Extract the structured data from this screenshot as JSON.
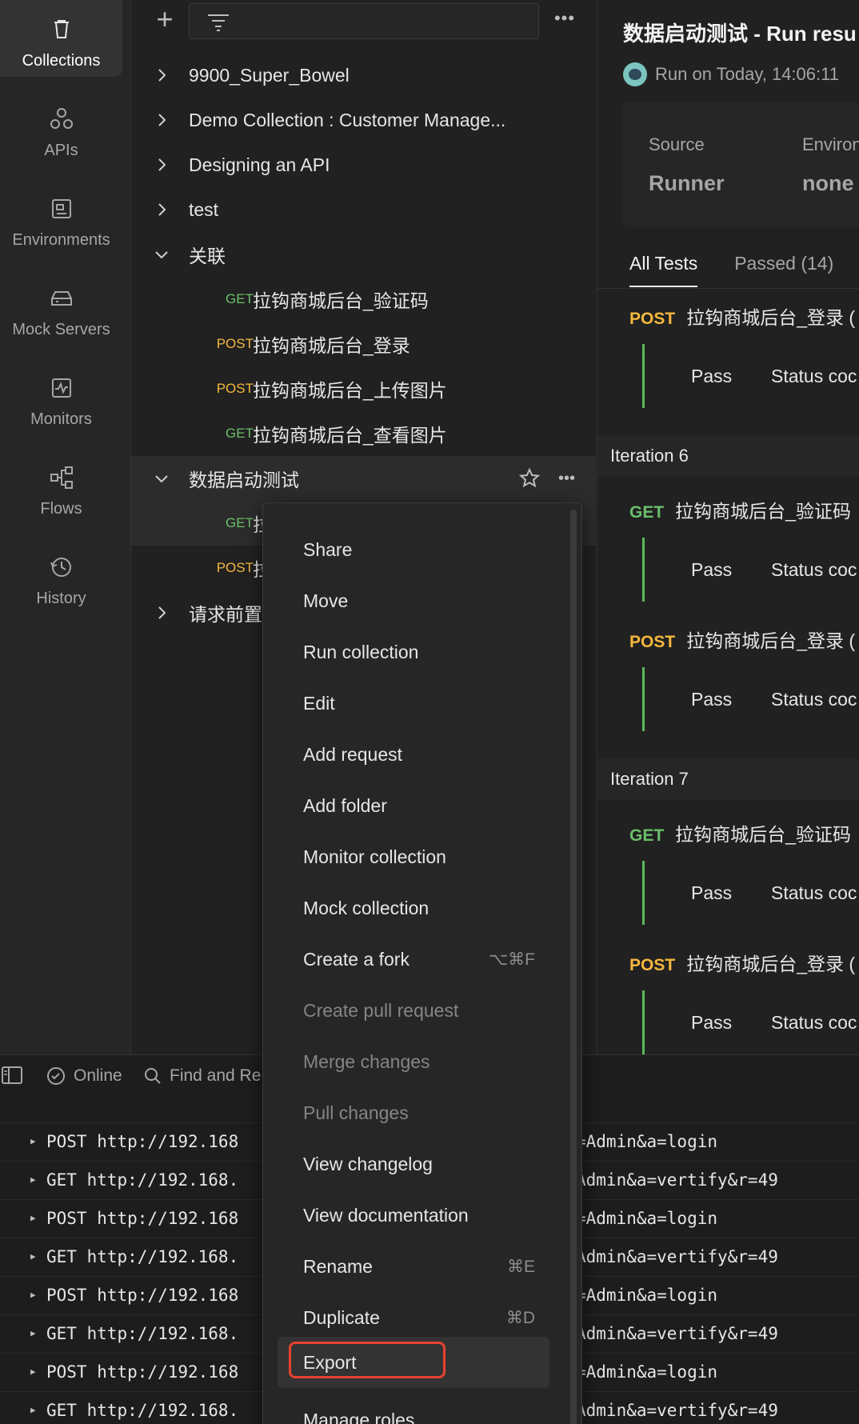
{
  "rail": {
    "items": [
      {
        "label": "Collections",
        "icon": "trash-bin-icon"
      },
      {
        "label": "APIs",
        "icon": "apis-icon"
      },
      {
        "label": "Environments",
        "icon": "environment-icon"
      },
      {
        "label": "Mock Servers",
        "icon": "server-icon"
      },
      {
        "label": "Monitors",
        "icon": "monitor-icon"
      },
      {
        "label": "Flows",
        "icon": "flows-icon"
      },
      {
        "label": "History",
        "icon": "history-icon"
      }
    ]
  },
  "tree": {
    "toolbar": {
      "add": "+",
      "more": "•••"
    },
    "rows": [
      {
        "name": "9900_Super_Bowel"
      },
      {
        "name": "Demo Collection : Customer Manage..."
      },
      {
        "name": "Designing an API"
      },
      {
        "name": "test"
      },
      {
        "name": "关联"
      },
      {
        "method": "GET",
        "name": "拉钩商城后台_验证码"
      },
      {
        "method": "POST",
        "name": "拉钩商城后台_登录"
      },
      {
        "method": "POST",
        "name": "拉钩商城后台_上传图片"
      },
      {
        "method": "GET",
        "name": "拉钩商城后台_查看图片"
      },
      {
        "name": "数据启动测试"
      },
      {
        "method": "GET",
        "name": "拉"
      },
      {
        "method": "POST",
        "name": "拉"
      },
      {
        "name": "请求前置"
      }
    ],
    "row_more": "•••"
  },
  "results": {
    "title": "数据启动测试 - Run resu",
    "run_on": "Run on Today, 14:06:11",
    "source_label": "Source",
    "source_value": "Runner",
    "env_label": "Environ",
    "env_value": "none",
    "tabs": [
      "All Tests",
      "Passed (14)"
    ],
    "post_label": "POST",
    "get_label": "GET",
    "req_login": "拉钩商城后台_登录 (",
    "req_captcha": "拉钩商城后台_验证码",
    "pass": "Pass",
    "status_code": "Status coc",
    "iteration6": "Iteration 6",
    "iteration7": "Iteration 7"
  },
  "console": {
    "online": "Online",
    "find": "Find and Re",
    "logs": [
      {
        "left": "POST http://192.168",
        "right": "=Admin&a=login"
      },
      {
        "left": "GET http://192.168.",
        "right": "Admin&a=vertify&r=49"
      },
      {
        "left": "POST http://192.168",
        "right": "=Admin&a=login"
      },
      {
        "left": "GET http://192.168.",
        "right": "Admin&a=vertify&r=49"
      },
      {
        "left": "POST http://192.168",
        "right": "=Admin&a=login"
      },
      {
        "left": "GET http://192.168.",
        "right": "Admin&a=vertify&r=49"
      },
      {
        "left": "POST http://192.168",
        "right": "=Admin&a=login"
      },
      {
        "left": "GET http://192.168.",
        "right": "Admin&a=vertify&r=49"
      }
    ]
  },
  "menu": {
    "items": [
      {
        "label": "Share"
      },
      {
        "label": "Move"
      },
      {
        "label": "Run collection"
      },
      {
        "label": "Edit"
      },
      {
        "label": "Add request"
      },
      {
        "label": "Add folder"
      },
      {
        "label": "Monitor collection"
      },
      {
        "label": "Mock collection"
      },
      {
        "label": "Create a fork",
        "shortcut": "⌥⌘F"
      },
      {
        "label": "Create pull request"
      },
      {
        "label": "Merge changes"
      },
      {
        "label": "Pull changes"
      },
      {
        "label": "View changelog"
      },
      {
        "label": "View documentation"
      },
      {
        "label": "Rename",
        "shortcut": "⌘E"
      },
      {
        "label": "Duplicate",
        "shortcut": "⌘D"
      },
      {
        "label": "Export"
      },
      {
        "label": "Manage roles"
      }
    ]
  },
  "colors": {
    "get": "#6bbf6b",
    "post": "#f5b83d",
    "pass_bar": "#5cb85c",
    "highlight_ring": "#e8412f"
  }
}
